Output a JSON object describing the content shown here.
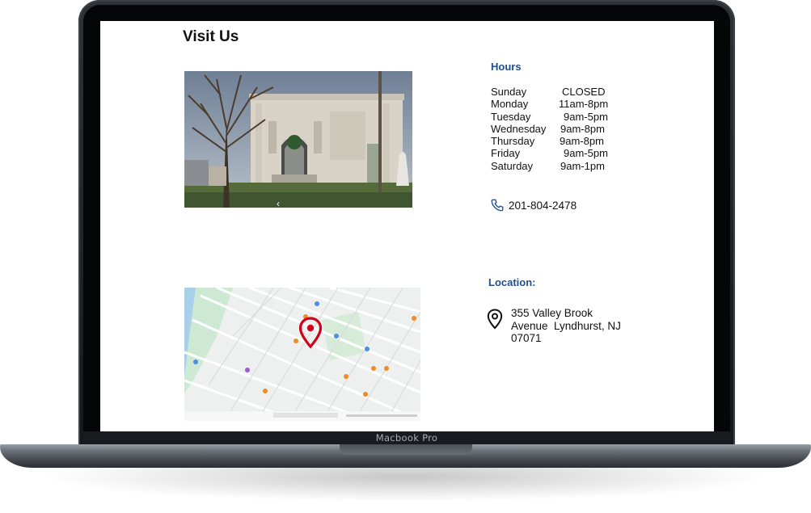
{
  "device": {
    "label": "Macbook Pro"
  },
  "page": {
    "title": "Visit Us"
  },
  "hours": {
    "heading": "Hours",
    "rows": [
      {
        "day": "Sunday",
        "time": "CLOSED"
      },
      {
        "day": "Monday",
        "time": "11am-8pm"
      },
      {
        "day": "Tuesday",
        "time": "9am-5pm"
      },
      {
        "day": "Wednesday",
        "time": "9am-8pm"
      },
      {
        "day": "Thursday",
        "time": "9am-8pm"
      },
      {
        "day": "Friday",
        "time": "9am-5pm"
      },
      {
        "day": "Saturday",
        "time": "9am-1pm"
      }
    ],
    "phone": "201-804-2478"
  },
  "location": {
    "heading": "Location:",
    "address_line1": "355 Valley Brook",
    "address_line2": "Avenue  Lyndhurst, NJ",
    "address_line3": "07071"
  },
  "icons": {
    "phone": "phone-icon",
    "location": "location-pin-icon",
    "map_marker": "map-marker-icon",
    "photo_prev": "chevron-left-icon"
  },
  "colors": {
    "heading_blue": "#1f4f8f",
    "marker_red": "#d0021b"
  }
}
